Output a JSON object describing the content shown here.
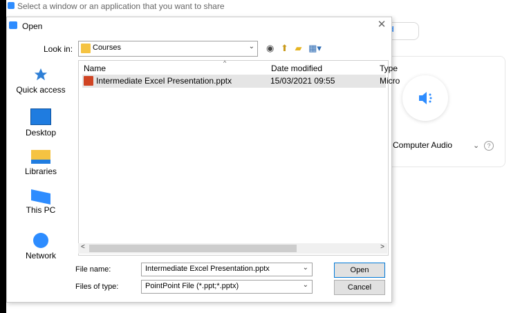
{
  "topbar": {
    "text": "Select a window or an application that you want to share"
  },
  "background_panel": {
    "pill_text": "d",
    "audio_label": "Computer Audio",
    "help_icon": "?"
  },
  "dialog": {
    "title": "Open",
    "close": "✕",
    "look_in_label": "Look in:",
    "look_in_value": "Courses",
    "toolbar_icons": [
      "back-icon",
      "up-folder-icon",
      "new-folder-icon",
      "view-menu-icon"
    ],
    "sidebar": [
      {
        "label": "Quick access",
        "icon": "star-icon"
      },
      {
        "label": "Desktop",
        "icon": "desktop-icon"
      },
      {
        "label": "Libraries",
        "icon": "libraries-icon"
      },
      {
        "label": "This PC",
        "icon": "computer-icon"
      },
      {
        "label": "Network",
        "icon": "network-icon"
      }
    ],
    "columns": {
      "name": "Name",
      "date": "Date modified",
      "type": "Type"
    },
    "files": [
      {
        "name": "Intermediate Excel Presentation.pptx",
        "date": "15/03/2021 09:55",
        "type": "Micro"
      }
    ],
    "file_name_label": "File name:",
    "file_name_value": "Intermediate Excel Presentation.pptx",
    "files_of_type_label": "Files of type:",
    "files_of_type_value": "PointPoint File (*.ppt;*.pptx)",
    "open_button": "Open",
    "cancel_button": "Cancel"
  }
}
